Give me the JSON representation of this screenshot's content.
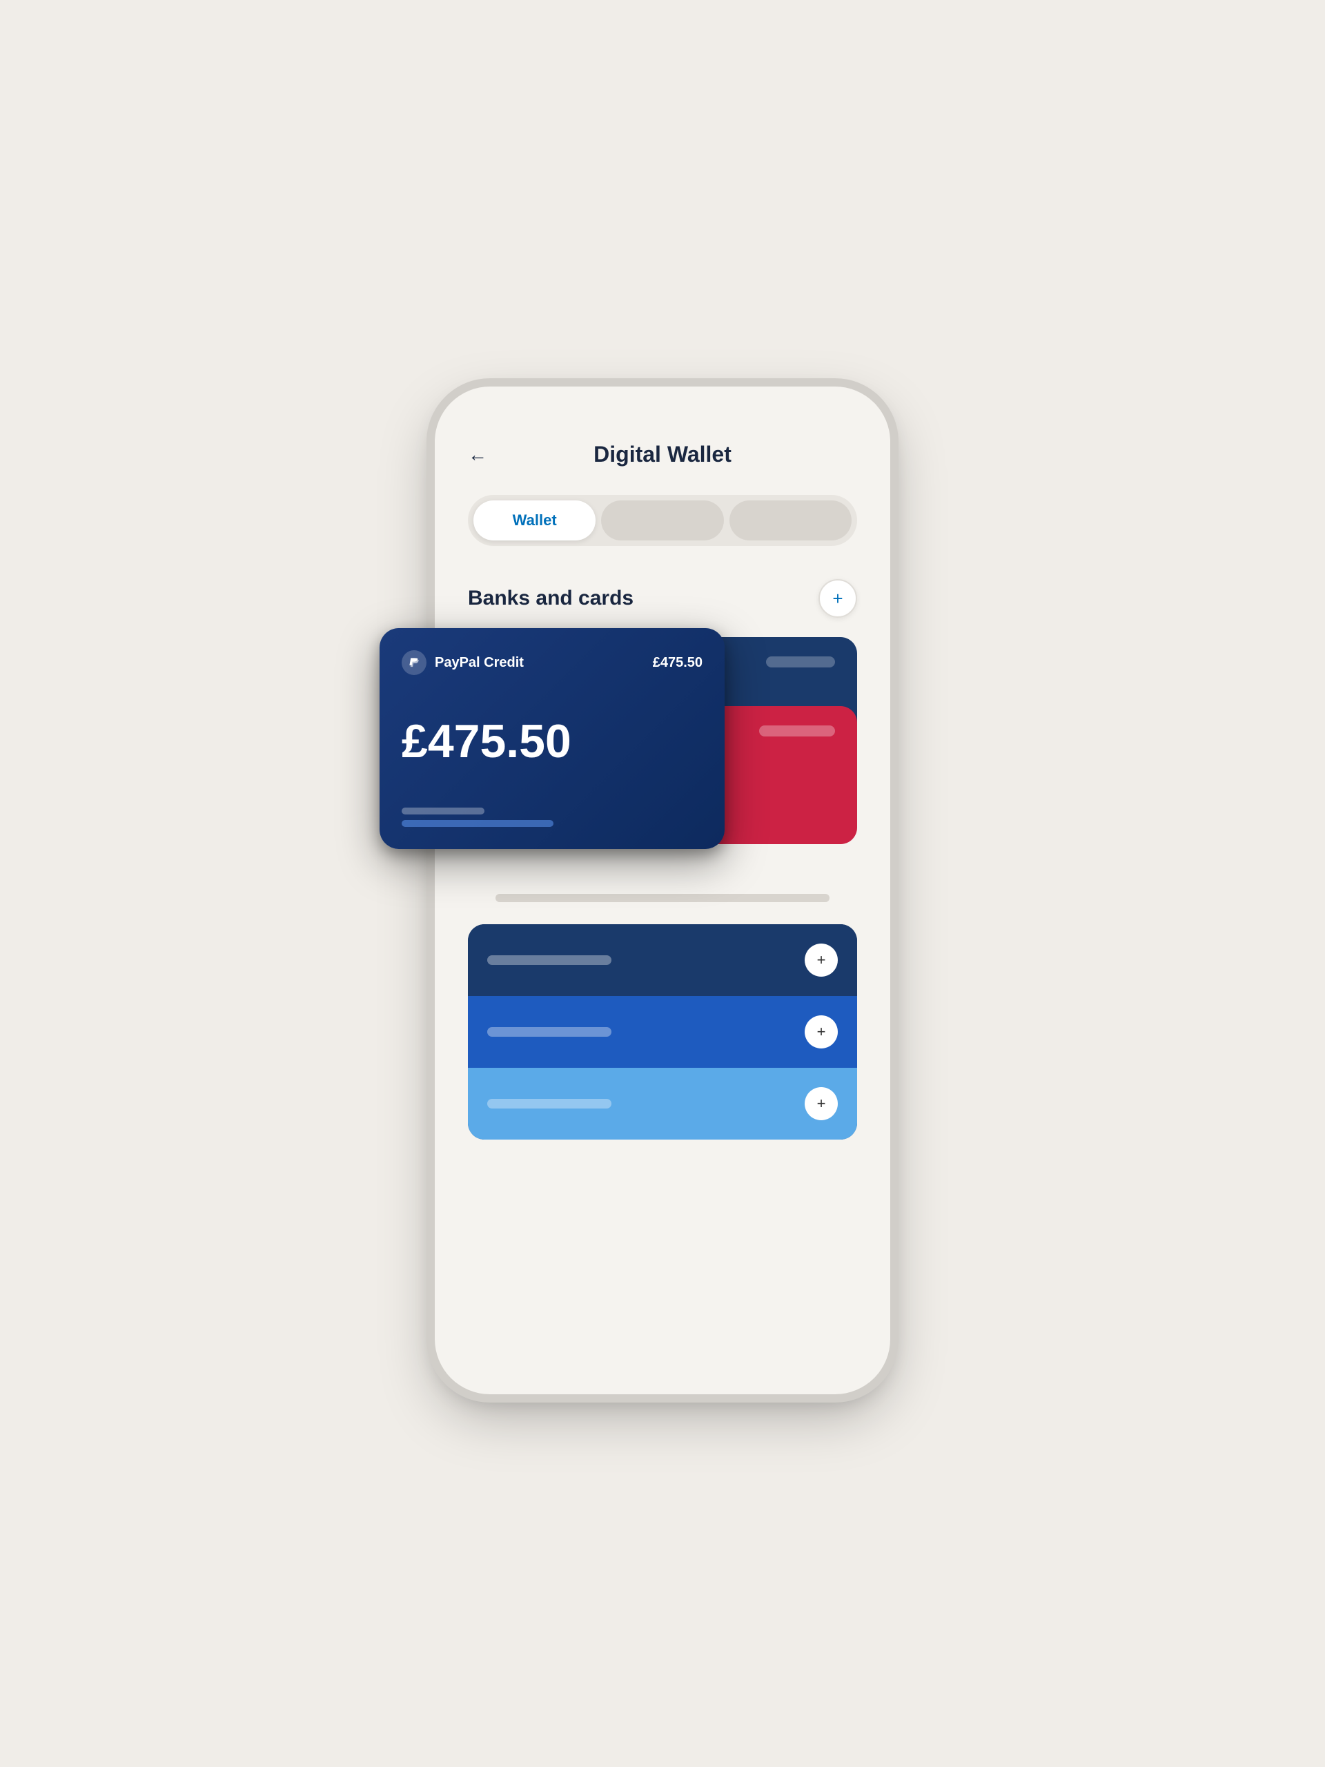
{
  "page": {
    "background_color": "#f0ede8"
  },
  "header": {
    "back_label": "←",
    "title": "Digital Wallet"
  },
  "tabs": [
    {
      "id": "wallet",
      "label": "Wallet",
      "active": true
    },
    {
      "id": "tab2",
      "label": "",
      "active": false
    },
    {
      "id": "tab3",
      "label": "",
      "active": false
    }
  ],
  "section": {
    "title": "Banks and cards",
    "add_button_label": "+"
  },
  "paypal_card": {
    "brand": "PayPal Credit",
    "amount_top": "£475.50",
    "amount_large": "£475.50"
  },
  "add_rows": [
    {
      "id": "row1",
      "plus": "+"
    },
    {
      "id": "row2",
      "plus": "+"
    },
    {
      "id": "row3",
      "plus": "+"
    }
  ]
}
